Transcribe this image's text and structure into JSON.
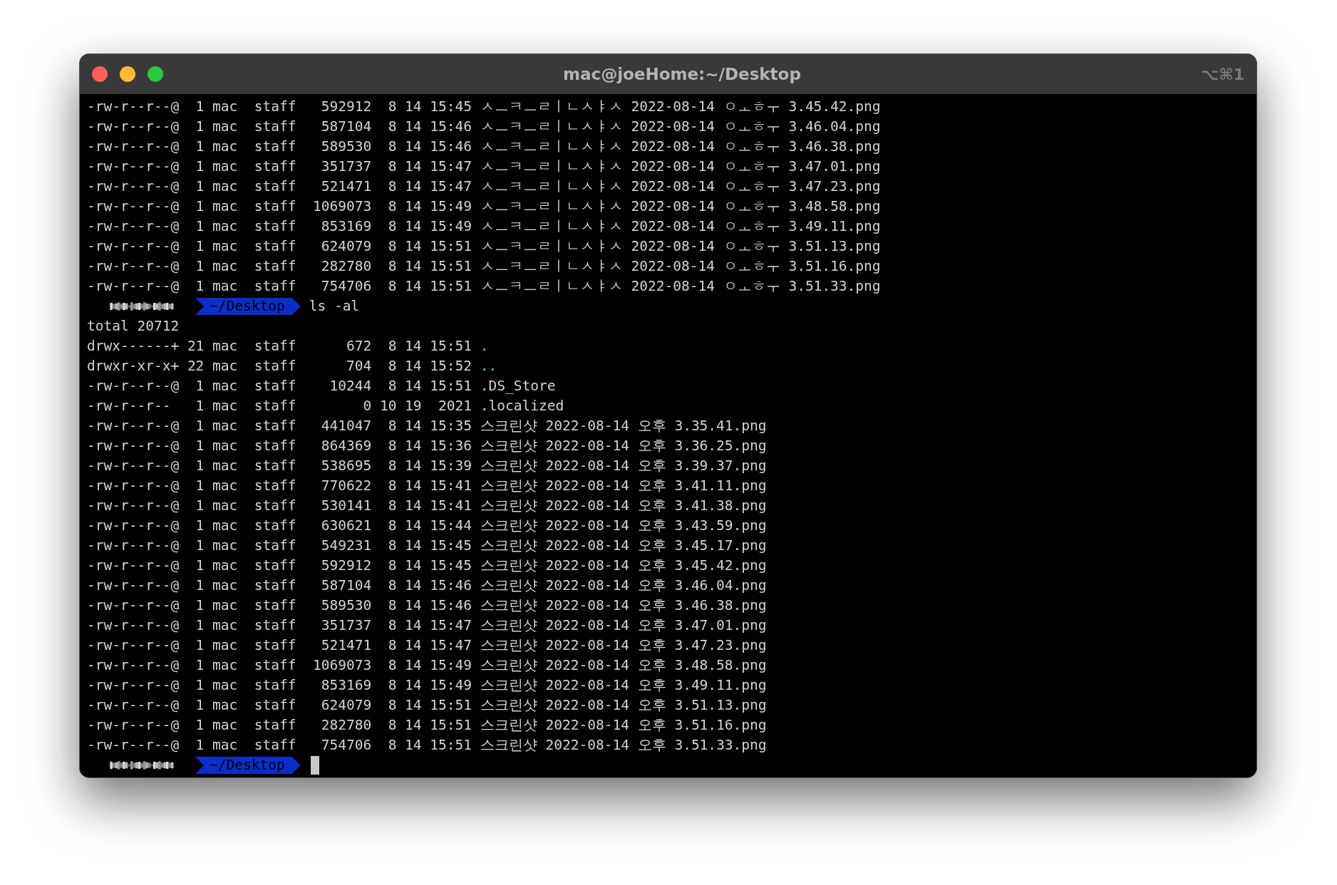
{
  "window": {
    "title": "mac@joeHome:~/Desktop",
    "shortcut": "⌥⌘1"
  },
  "lines": [
    {
      "kind": "file",
      "info": "-rw-r--r--@  1 mac  staff   592912  8 14 15:45 ",
      "name": "ㅅㅡㅋㅡㄹㅣㄴㅅㅑㅅ 2022-08-14 ㅇㅗㅎㅜ 3.45.42.png"
    },
    {
      "kind": "file",
      "info": "-rw-r--r--@  1 mac  staff   587104  8 14 15:46 ",
      "name": "ㅅㅡㅋㅡㄹㅣㄴㅅㅑㅅ 2022-08-14 ㅇㅗㅎㅜ 3.46.04.png"
    },
    {
      "kind": "file",
      "info": "-rw-r--r--@  1 mac  staff   589530  8 14 15:46 ",
      "name": "ㅅㅡㅋㅡㄹㅣㄴㅅㅑㅅ 2022-08-14 ㅇㅗㅎㅜ 3.46.38.png"
    },
    {
      "kind": "file",
      "info": "-rw-r--r--@  1 mac  staff   351737  8 14 15:47 ",
      "name": "ㅅㅡㅋㅡㄹㅣㄴㅅㅑㅅ 2022-08-14 ㅇㅗㅎㅜ 3.47.01.png"
    },
    {
      "kind": "file",
      "info": "-rw-r--r--@  1 mac  staff   521471  8 14 15:47 ",
      "name": "ㅅㅡㅋㅡㄹㅣㄴㅅㅑㅅ 2022-08-14 ㅇㅗㅎㅜ 3.47.23.png"
    },
    {
      "kind": "file",
      "info": "-rw-r--r--@  1 mac  staff  1069073  8 14 15:49 ",
      "name": "ㅅㅡㅋㅡㄹㅣㄴㅅㅑㅅ 2022-08-14 ㅇㅗㅎㅜ 3.48.58.png"
    },
    {
      "kind": "file",
      "info": "-rw-r--r--@  1 mac  staff   853169  8 14 15:49 ",
      "name": "ㅅㅡㅋㅡㄹㅣㄴㅅㅑㅅ 2022-08-14 ㅇㅗㅎㅜ 3.49.11.png"
    },
    {
      "kind": "file",
      "info": "-rw-r--r--@  1 mac  staff   624079  8 14 15:51 ",
      "name": "ㅅㅡㅋㅡㄹㅣㄴㅅㅑㅅ 2022-08-14 ㅇㅗㅎㅜ 3.51.13.png"
    },
    {
      "kind": "file",
      "info": "-rw-r--r--@  1 mac  staff   282780  8 14 15:51 ",
      "name": "ㅅㅡㅋㅡㄹㅣㄴㅅㅑㅅ 2022-08-14 ㅇㅗㅎㅜ 3.51.16.png"
    },
    {
      "kind": "file",
      "info": "-rw-r--r--@  1 mac  staff   754706  8 14 15:51 ",
      "name": "ㅅㅡㅋㅡㄹㅣㄴㅅㅑㅅ 2022-08-14 ㅇㅗㅎㅜ 3.51.33.png"
    },
    {
      "kind": "prompt",
      "path": "~/Desktop",
      "command": "ls -al",
      "cursor": false
    },
    {
      "kind": "text",
      "text": "total 20712"
    },
    {
      "kind": "dir",
      "info": "drwx------+ 21 mac  staff      672  8 14 15:51 ",
      "name": "."
    },
    {
      "kind": "dir",
      "info": "drwxr-xr-x+ 22 mac  staff      704  8 14 15:52 ",
      "name": ".."
    },
    {
      "kind": "file",
      "info": "-rw-r--r--@  1 mac  staff    10244  8 14 15:51 ",
      "name": ".DS_Store"
    },
    {
      "kind": "file",
      "info": "-rw-r--r--   1 mac  staff        0 10 19  2021 ",
      "name": ".localized"
    },
    {
      "kind": "file",
      "info": "-rw-r--r--@  1 mac  staff   441047  8 14 15:35 ",
      "name": "스크린샷 2022-08-14 오후 3.35.41.png"
    },
    {
      "kind": "file",
      "info": "-rw-r--r--@  1 mac  staff   864369  8 14 15:36 ",
      "name": "스크린샷 2022-08-14 오후 3.36.25.png"
    },
    {
      "kind": "file",
      "info": "-rw-r--r--@  1 mac  staff   538695  8 14 15:39 ",
      "name": "스크린샷 2022-08-14 오후 3.39.37.png"
    },
    {
      "kind": "file",
      "info": "-rw-r--r--@  1 mac  staff   770622  8 14 15:41 ",
      "name": "스크린샷 2022-08-14 오후 3.41.11.png"
    },
    {
      "kind": "file",
      "info": "-rw-r--r--@  1 mac  staff   530141  8 14 15:41 ",
      "name": "스크린샷 2022-08-14 오후 3.41.38.png"
    },
    {
      "kind": "file",
      "info": "-rw-r--r--@  1 mac  staff   630621  8 14 15:44 ",
      "name": "스크린샷 2022-08-14 오후 3.43.59.png"
    },
    {
      "kind": "file",
      "info": "-rw-r--r--@  1 mac  staff   549231  8 14 15:45 ",
      "name": "스크린샷 2022-08-14 오후 3.45.17.png"
    },
    {
      "kind": "file",
      "info": "-rw-r--r--@  1 mac  staff   592912  8 14 15:45 ",
      "name": "스크린샷 2022-08-14 오후 3.45.42.png"
    },
    {
      "kind": "file",
      "info": "-rw-r--r--@  1 mac  staff   587104  8 14 15:46 ",
      "name": "스크린샷 2022-08-14 오후 3.46.04.png"
    },
    {
      "kind": "file",
      "info": "-rw-r--r--@  1 mac  staff   589530  8 14 15:46 ",
      "name": "스크린샷 2022-08-14 오후 3.46.38.png"
    },
    {
      "kind": "file",
      "info": "-rw-r--r--@  1 mac  staff   351737  8 14 15:47 ",
      "name": "스크린샷 2022-08-14 오후 3.47.01.png"
    },
    {
      "kind": "file",
      "info": "-rw-r--r--@  1 mac  staff   521471  8 14 15:47 ",
      "name": "스크린샷 2022-08-14 오후 3.47.23.png"
    },
    {
      "kind": "file",
      "info": "-rw-r--r--@  1 mac  staff  1069073  8 14 15:49 ",
      "name": "스크린샷 2022-08-14 오후 3.48.58.png"
    },
    {
      "kind": "file",
      "info": "-rw-r--r--@  1 mac  staff   853169  8 14 15:49 ",
      "name": "스크린샷 2022-08-14 오후 3.49.11.png"
    },
    {
      "kind": "file",
      "info": "-rw-r--r--@  1 mac  staff   624079  8 14 15:51 ",
      "name": "스크린샷 2022-08-14 오후 3.51.13.png"
    },
    {
      "kind": "file",
      "info": "-rw-r--r--@  1 mac  staff   282780  8 14 15:51 ",
      "name": "스크린샷 2022-08-14 오후 3.51.16.png"
    },
    {
      "kind": "file",
      "info": "-rw-r--r--@  1 mac  staff   754706  8 14 15:51 ",
      "name": "스크린샷 2022-08-14 오후 3.51.33.png"
    },
    {
      "kind": "prompt",
      "path": "~/Desktop",
      "cursor": true
    }
  ]
}
